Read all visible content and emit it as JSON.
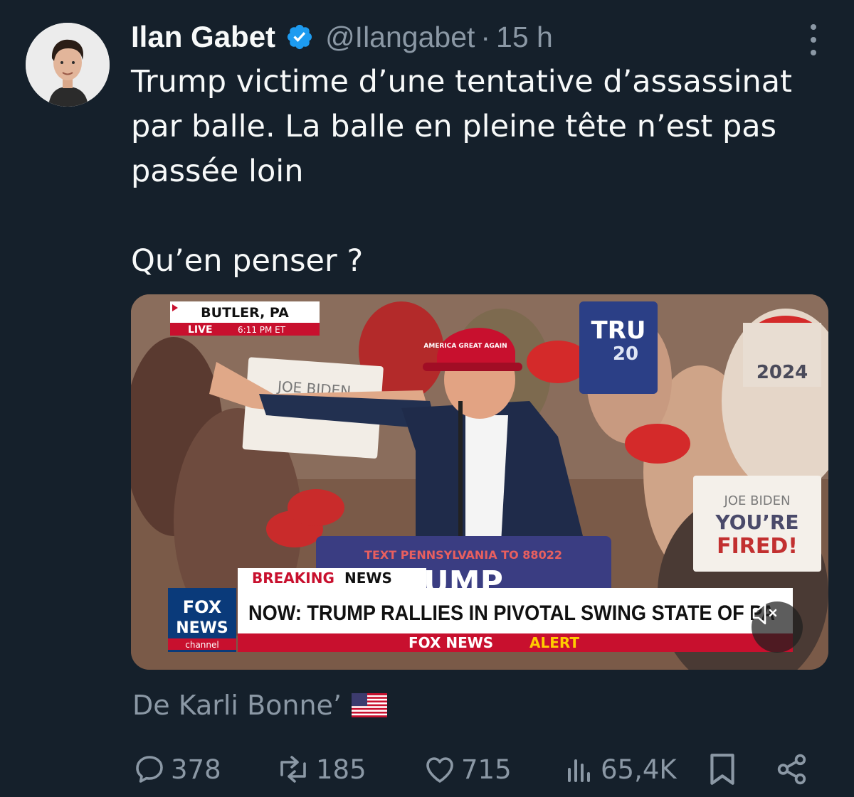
{
  "author": {
    "name": "Ilan Gabet",
    "handle": "@Ilangabet",
    "time": "15 h",
    "verified": true
  },
  "tweet": {
    "text": "Trump victime d’une tentative d’assassinat\npar balle. La balle en pleine tête n’est pas\npassée loin",
    "question": "Qu’en penser ?"
  },
  "video": {
    "location": "BUTLER, PA",
    "live_label": "LIVE",
    "live_time": "6:11 PM ET",
    "sign_biden": "JOE BIDEN",
    "sign_top": "TRU",
    "sign_top_year": "20",
    "sign_2024": "2024",
    "sign_right_line1": "JOE BIDEN",
    "sign_right_line2": "YOU’RE",
    "sign_right_line3": "FIRED!",
    "podium_text": "TEXT PENNSYLVANIA TO 88022",
    "podium_big": "RUMP",
    "breaking_label_1": "BREAKING",
    "breaking_label_2": "NEWS",
    "headline": "NOW: TRUMP RALLIES IN PIVOTAL SWING STATE OF PA",
    "alert_label_1": "FOX NEWS",
    "alert_label_2": "ALERT",
    "logo_fox": "FOX",
    "logo_news": "NEWS",
    "logo_channel": "channel",
    "hat_text": "AMERICA GREAT AGAIN"
  },
  "source": {
    "text": "De Karli Bonne’",
    "flag_icon": "us-flag-emoji"
  },
  "actions": {
    "replies": "378",
    "reposts": "185",
    "likes": "715",
    "views": "65,4K"
  },
  "colors": {
    "background": "#15202b",
    "text": "#f7f9f9",
    "secondary": "#8b98a5",
    "verified": "#1d9bf0",
    "fox_red": "#c8102e",
    "fox_blue": "#003366"
  }
}
